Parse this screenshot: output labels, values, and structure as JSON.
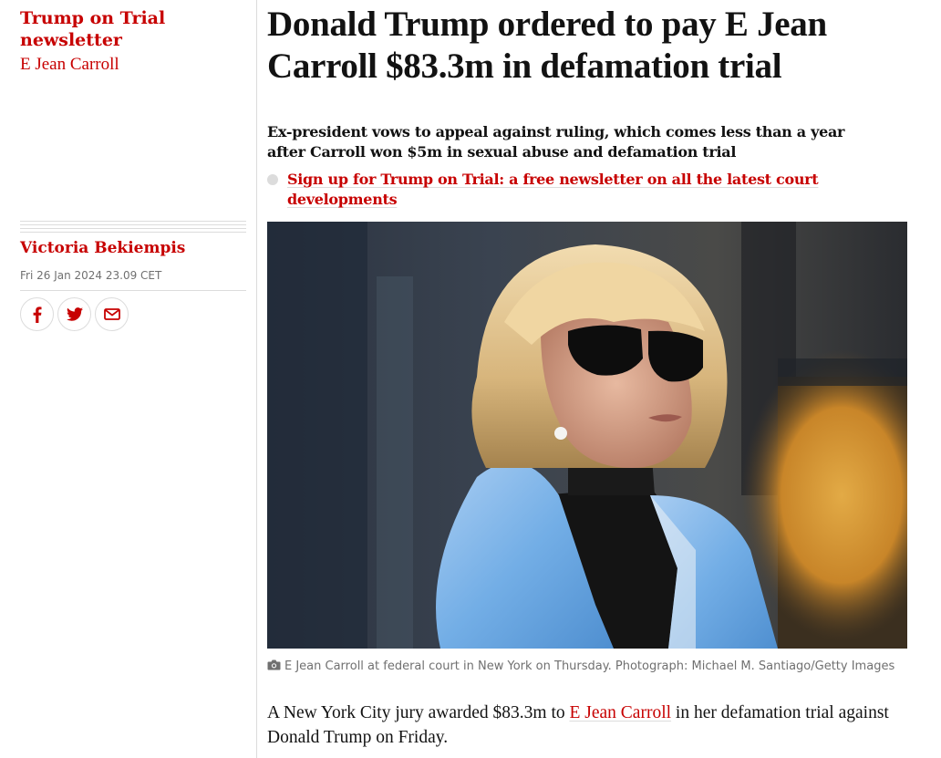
{
  "series": {
    "title": "Trump on Trial newsletter",
    "subtitle": "E Jean Carroll"
  },
  "meta": {
    "author": "Victoria Bekiempis",
    "date": "Fri 26 Jan 2024 23.09 CET",
    "share": [
      {
        "icon": "facebook-icon"
      },
      {
        "icon": "twitter-icon"
      },
      {
        "icon": "email-icon"
      }
    ]
  },
  "article": {
    "headline": "Donald Trump ordered to pay E Jean Carroll $83.3m in defamation trial",
    "standfirst": "Ex-president vows to appeal against ruling, which comes less than a year after Carroll won $5m in sexual abuse and defamation trial",
    "signup_link": "Sign up for Trump on Trial: a free newsletter on all the latest court developments",
    "caption": "E Jean Carroll at federal court in New York on Thursday. Photograph: Michael M. Santiago/Getty Images",
    "body": {
      "before": "A New York City jury awarded $83.3m to ",
      "link": "E Jean Carroll",
      "after": " in her defamation trial against Donald Trump on Friday."
    }
  },
  "colors": {
    "accent": "#c70000",
    "text": "#121212",
    "muted": "#707070",
    "rule": "#dcdcdc"
  }
}
